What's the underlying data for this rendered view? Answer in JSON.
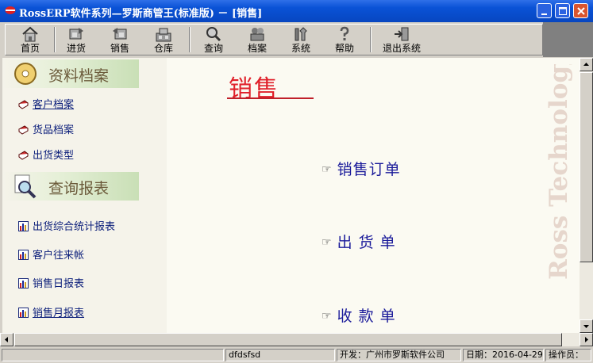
{
  "window": {
    "title": "RossERP软件系列—罗斯商管王(标准版) － [销售]"
  },
  "toolbar": {
    "buttons": [
      {
        "label": "首页",
        "icon": "home-icon"
      },
      {
        "label": "进货",
        "icon": "purchase-icon"
      },
      {
        "label": "销售",
        "icon": "sales-icon"
      },
      {
        "label": "仓库",
        "icon": "warehouse-icon"
      },
      {
        "label": "查询",
        "icon": "search-icon"
      },
      {
        "label": "档案",
        "icon": "archive-icon"
      },
      {
        "label": "系统",
        "icon": "tools-icon"
      },
      {
        "label": "帮助",
        "icon": "help-icon"
      },
      {
        "label": "退出系统",
        "icon": "exit-icon"
      }
    ]
  },
  "sidebar": {
    "sections": [
      {
        "title": "资料档案",
        "icon": "cd-icon",
        "items": [
          {
            "label": "客户档案",
            "icon": "book-icon"
          },
          {
            "label": "货品档案",
            "icon": "book-icon"
          },
          {
            "label": "出货类型",
            "icon": "book-icon"
          }
        ]
      },
      {
        "title": "查询报表",
        "icon": "magnifier-icon",
        "items": [
          {
            "label": "出货综合统计报表",
            "icon": "report-icon"
          },
          {
            "label": "客户往来帐",
            "icon": "report-icon"
          },
          {
            "label": "销售日报表",
            "icon": "report-icon"
          },
          {
            "label": "销售月报表",
            "icon": "report-icon"
          }
        ]
      }
    ]
  },
  "main": {
    "title": "销售",
    "actions": [
      "销售订单",
      "出 货 单",
      "收 款 单"
    ],
    "watermark": "Ross Technology"
  },
  "statusbar": {
    "user": "dfdsfsd",
    "developer": "开发：广州市罗斯软件公司",
    "date": "日期：2016-04-29",
    "operator": "操作员："
  },
  "colors": {
    "title_red": "#e0202a",
    "link_blue": "#0a1d7a",
    "titlebar_blue": "#0a52d6"
  }
}
